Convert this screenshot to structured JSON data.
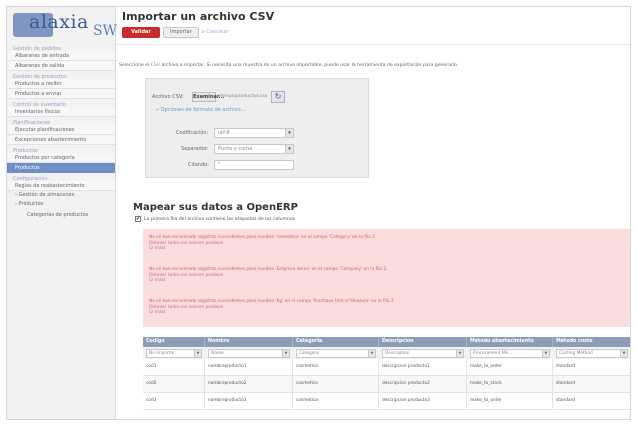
{
  "brand": {
    "logo_text": "alaxia",
    "logo_suffix": "SW"
  },
  "sidebar": {
    "sections": [
      {
        "label": "Gestión de pedidos",
        "items": [
          "Albaranes de entrada",
          "Albaranes de salida"
        ]
      },
      {
        "label": "Gestión de productos",
        "items": [
          "Productos a recibir",
          "Productos a enviar"
        ]
      },
      {
        "label": "Control de inventario",
        "items": [
          "Inventarios físicos"
        ]
      },
      {
        "label": "Planificaciones",
        "items": [
          "Ejecutar planificaciones",
          "Excepciones abastecimiento"
        ]
      },
      {
        "label": "Productos",
        "items": [
          "Productos por categoría",
          "Productos"
        ]
      },
      {
        "label": "Configuración",
        "items": [
          "Reglas de reabastecimiento"
        ]
      }
    ],
    "tree": [
      "Gestión de almacenes",
      "Productos"
    ],
    "tree_sub": [
      "Categorías de productos"
    ]
  },
  "header": {
    "title": "Importar un archivo CSV",
    "validate_label": "Validar",
    "import_label": "Importar",
    "or_label": "o",
    "cancel_label": "Cancelar"
  },
  "intro": {
    "pre": "Seleccione el ",
    "link": "CSV",
    "post": " archivo a importar. Si necesita una muestra de un archivo importable, puede usar la herramienta de exportación para generarlo."
  },
  "form": {
    "file_label": "Archivo CSV:",
    "browse_label": "Examinar...",
    "file_name": "ejemploproductos.csv",
    "options_label": "» Opciones de formato de archivo…",
    "encoding_label": "Codificación:",
    "encoding_value": "utf-8",
    "separator_label": "Separador:",
    "separator_value": "Punto y coma",
    "quote_label": "Citando:",
    "quote_value": "\""
  },
  "mapping": {
    "title": "Mapear sus datos a OpenERP",
    "first_row_label": "La primera fila del archivo contiene las etiquetas de las columnas",
    "first_row_checked": true,
    "errors": [
      {
        "text": "No se han encontrado registros coincidentes para nombre 'cosmética' en el campo 'Category' en la fila 2.",
        "link1": "Obtener todos los valores posibles",
        "link2": "(2 más)"
      },
      {
        "text": "No se han encontrado registros coincidentes para nombre 'Empresa demo' en el campo 'Company' en la fila 2.",
        "link1": "Obtener todos los valores posibles",
        "link2": "(2 más)"
      },
      {
        "text": "No se han encontrado registros coincidentes para nombre 'Kg' en el campo 'Purchase Unit of Measure' en la fila 2.",
        "link1": "Obtener todos los valores posibles",
        "link2": "(2 más)"
      }
    ]
  },
  "table": {
    "headers": [
      "Codigo",
      "Nombre",
      "Categoria",
      "Descripcion",
      "Método abastecimiento",
      "Método coste"
    ],
    "filters": [
      "No importar",
      "Name",
      "Category",
      "Description",
      "Procurement Me…",
      "Costing Method"
    ],
    "rows": [
      [
        "cod1",
        "nombreproducto1",
        "cosmetica",
        "descripcion producto1",
        "make_to_order",
        "standard"
      ],
      [
        "cod2",
        "nombreproducto2",
        "cosmetica",
        "descripcion producto2",
        "make_to_stock",
        "standard"
      ],
      [
        "cod3",
        "nombreproducto3",
        "cosmetica",
        "descripcion producto3",
        "make_to_order",
        "standard"
      ]
    ]
  },
  "colors": {
    "accent": "#c92a2a",
    "sidebar_active": "#6f8fc9",
    "table_header": "#8d9db8",
    "error_bg": "#fbdddd",
    "error_text": "#d85f5f"
  }
}
